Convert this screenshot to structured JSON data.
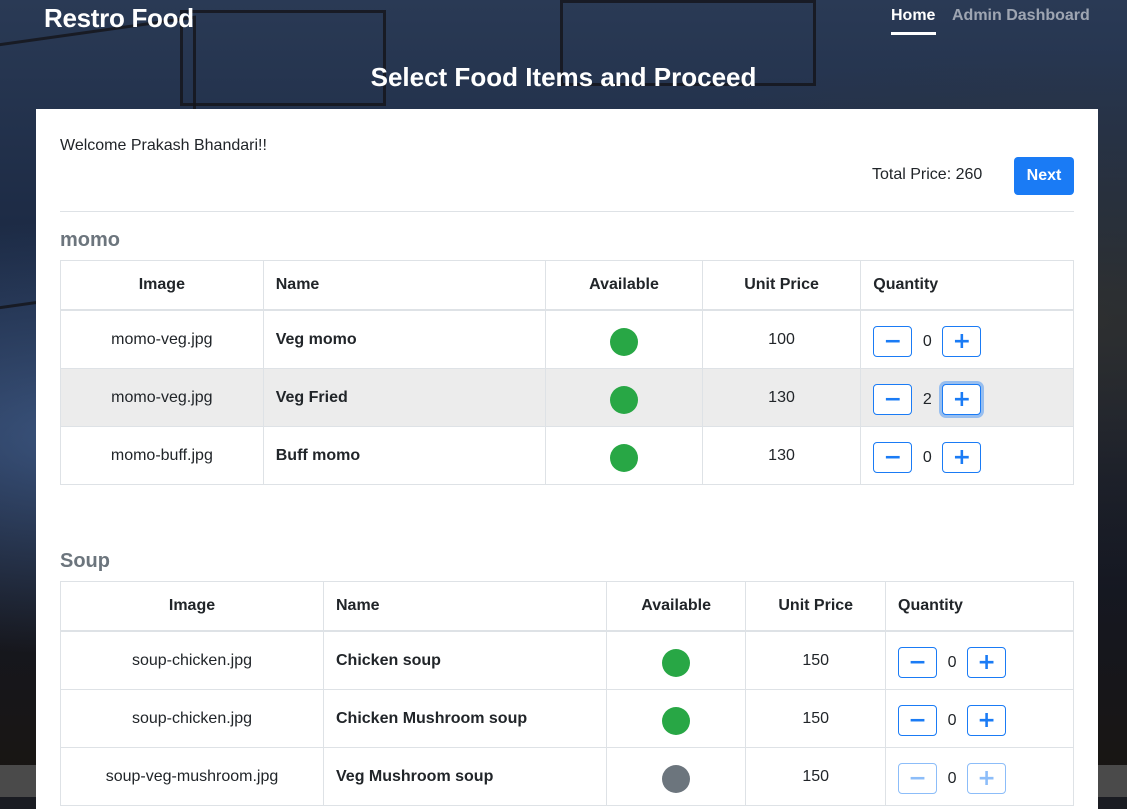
{
  "nav": {
    "brand": "Restro Food",
    "links": [
      {
        "label": "Home"
      },
      {
        "label": "Admin Dashboard"
      }
    ]
  },
  "page_title": "Select Food Items and Proceed",
  "welcome": "Welcome Prakash Bhandari!!",
  "total_price": "Total Price: 260",
  "next_label": "Next",
  "colors": {
    "accent": "#1a7bf5",
    "available": "#28a745",
    "unavailable": "#6c757d"
  },
  "columns": [
    "Image",
    "Name",
    "Available",
    "Unit Price",
    "Quantity"
  ],
  "categories": [
    {
      "title": "momo",
      "items": [
        {
          "image": "momo-veg.jpg",
          "name": "Veg momo",
          "available": true,
          "price": "100",
          "qty": "0"
        },
        {
          "image": "momo-veg.jpg",
          "name": "Veg Fried",
          "available": true,
          "price": "130",
          "qty": "2"
        },
        {
          "image": "momo-buff.jpg",
          "name": "Buff momo",
          "available": true,
          "price": "130",
          "qty": "0"
        }
      ]
    },
    {
      "title": "Soup",
      "items": [
        {
          "image": "soup-chicken.jpg",
          "name": "Chicken soup",
          "available": true,
          "price": "150",
          "qty": "0"
        },
        {
          "image": "soup-chicken.jpg",
          "name": "Chicken Mushroom soup",
          "available": true,
          "price": "150",
          "qty": "0"
        },
        {
          "image": "soup-veg-mushroom.jpg",
          "name": "Veg Mushroom soup",
          "available": false,
          "price": "150",
          "qty": "0"
        }
      ]
    }
  ],
  "icons": {
    "minus": "minus-icon",
    "plus": "plus-icon"
  }
}
